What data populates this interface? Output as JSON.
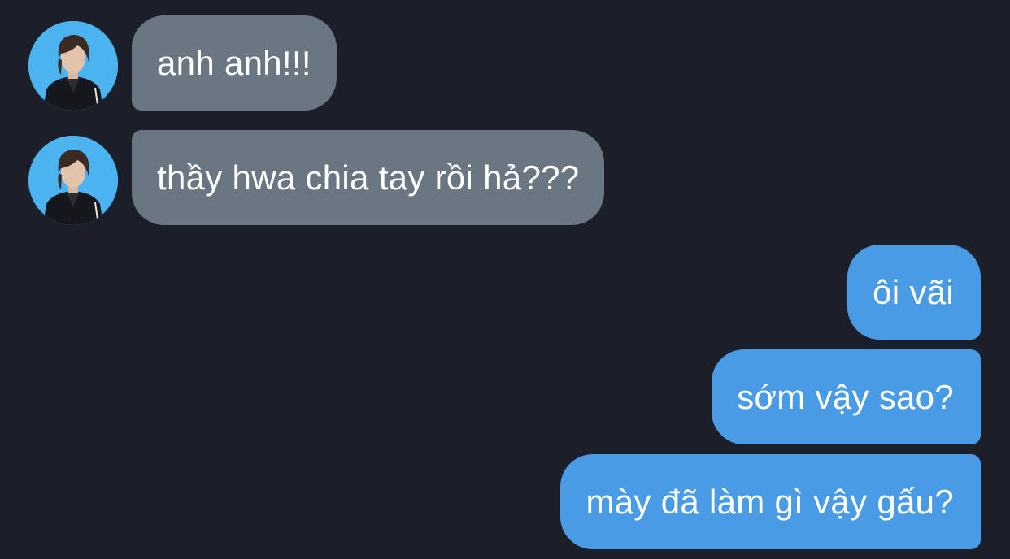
{
  "colors": {
    "background": "#1a1f29",
    "incoming_bubble": "#6a7682",
    "outgoing_bubble": "#4a9be6",
    "avatar_background": "#4bb3f0",
    "text": "#ffffff"
  },
  "conversation": {
    "incoming": [
      {
        "text": "anh anh!!!",
        "avatar": "avatar-photo"
      },
      {
        "text": "thầy hwa chia tay rồi hả???",
        "avatar": "avatar-photo"
      }
    ],
    "outgoing": [
      {
        "text": "ôi vãi"
      },
      {
        "text": "sớm vậy sao?"
      },
      {
        "text": "mày đã làm gì vậy gấu?"
      }
    ]
  }
}
